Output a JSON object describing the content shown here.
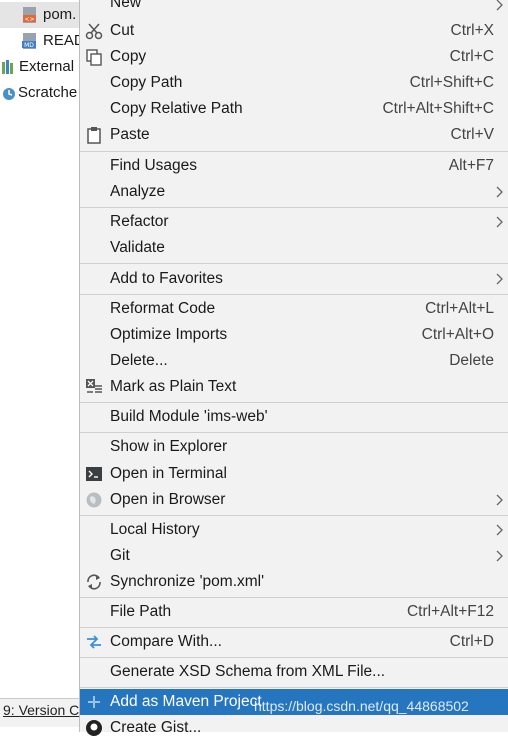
{
  "tree": [
    {
      "label": "pom.",
      "icon": "xml-file-icon",
      "selected": true
    },
    {
      "label": "READ",
      "icon": "markdown-file-icon",
      "selected": false
    },
    {
      "label": "External",
      "icon": "library-icon",
      "selected": false
    },
    {
      "label": "Scratche",
      "icon": "scratches-icon",
      "selected": false
    }
  ],
  "bottom_tab": "9: Version C",
  "menu": {
    "partial_top": "New",
    "items": [
      {
        "label": "Cut",
        "shortcut": "Ctrl+X",
        "icon": "scissors-icon"
      },
      {
        "label": "Copy",
        "shortcut": "Ctrl+C",
        "icon": "copy-icon"
      },
      {
        "label": "Copy Path",
        "shortcut": "Ctrl+Shift+C"
      },
      {
        "label": "Copy Relative Path",
        "shortcut": "Ctrl+Alt+Shift+C"
      },
      {
        "label": "Paste",
        "shortcut": "Ctrl+V",
        "icon": "clipboard-icon"
      },
      {
        "label": "Find Usages",
        "shortcut": "Alt+F7"
      },
      {
        "label": "Analyze",
        "submenu": true
      },
      {
        "label": "Refactor",
        "submenu": true
      },
      {
        "label": "Validate"
      },
      {
        "label": "Add to Favorites",
        "submenu": true
      },
      {
        "label": "Reformat Code",
        "shortcut": "Ctrl+Alt+L"
      },
      {
        "label": "Optimize Imports",
        "shortcut": "Ctrl+Alt+O"
      },
      {
        "label": "Delete...",
        "shortcut": "Delete"
      },
      {
        "label": "Mark as Plain Text",
        "icon": "plain-text-icon"
      },
      {
        "label": "Build Module 'ims-web'"
      },
      {
        "label": "Show in Explorer"
      },
      {
        "label": "Open in Terminal",
        "icon": "terminal-icon"
      },
      {
        "label": "Open in Browser",
        "icon": "globe-icon",
        "submenu": true
      },
      {
        "label": "Local History",
        "submenu": true
      },
      {
        "label": "Git",
        "submenu": true
      },
      {
        "label": "Synchronize 'pom.xml'",
        "icon": "sync-icon"
      },
      {
        "label": "File Path",
        "shortcut": "Ctrl+Alt+F12"
      },
      {
        "label": "Compare With...",
        "shortcut": "Ctrl+D",
        "icon": "compare-icon"
      },
      {
        "label": "Generate XSD Schema from XML File..."
      },
      {
        "label": "Add as Maven Project",
        "icon": "plus-icon",
        "highlighted": true
      },
      {
        "label": "Create Gist...",
        "icon": "github-icon"
      }
    ]
  },
  "watermark": "https://blog.csdn.net/qq_44868502",
  "colors": {
    "highlight": "#2675bf",
    "menu_bg": "#f2f2f2",
    "separator": "#d0d0d0"
  }
}
